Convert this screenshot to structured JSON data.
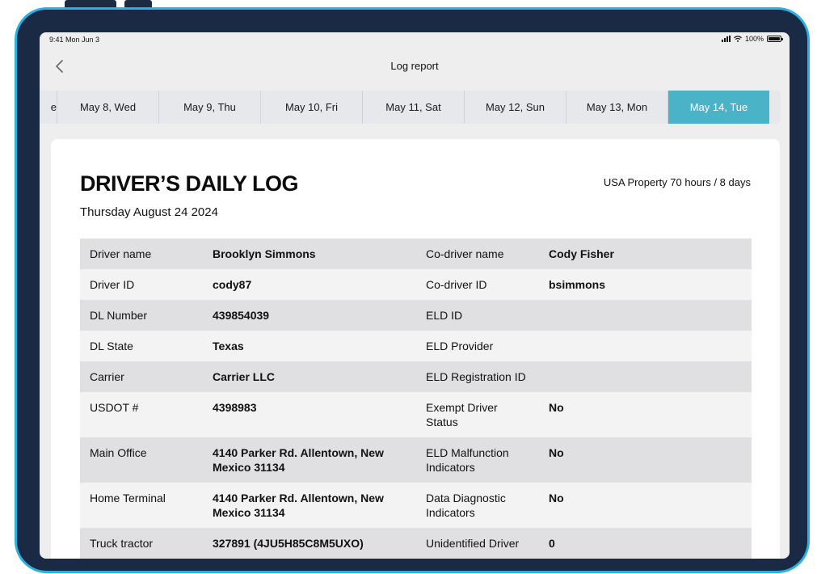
{
  "status_bar": {
    "time": "9:41 Mon Jun 3",
    "battery": "100%"
  },
  "nav": {
    "title": "Log report"
  },
  "date_tabs": [
    {
      "label": "e",
      "active": false
    },
    {
      "label": "May 8, Wed",
      "active": false
    },
    {
      "label": "May 9, Thu",
      "active": false
    },
    {
      "label": "May 10, Fri",
      "active": false
    },
    {
      "label": "May 11, Sat",
      "active": false
    },
    {
      "label": "May 12, Sun",
      "active": false
    },
    {
      "label": "May 13, Mon",
      "active": false
    },
    {
      "label": "May 14, Tue",
      "active": true
    }
  ],
  "document": {
    "title": "DRIVER’S DAILY LOG",
    "date": "Thursday August 24 2024",
    "regulation": "USA Property 70 hours / 8 days"
  },
  "rows": [
    {
      "label1": "Driver name",
      "value1": "Brooklyn Simmons",
      "label2": "Co-driver name",
      "value2": "Cody Fisher"
    },
    {
      "label1": "Driver ID",
      "value1": "cody87",
      "label2": "Co-driver ID",
      "value2": "bsimmons"
    },
    {
      "label1": "DL Number",
      "value1": "439854039",
      "label2": "ELD ID",
      "value2": ""
    },
    {
      "label1": "DL State",
      "value1": "Texas",
      "label2": "ELD Provider",
      "value2": ""
    },
    {
      "label1": "Carrier",
      "value1": "Carrier LLC",
      "label2": "ELD Registration ID",
      "value2": ""
    },
    {
      "label1": "USDOT #",
      "value1": "4398983",
      "label2": "Exempt Driver Status",
      "value2": "No"
    },
    {
      "label1": "Main Office",
      "value1": "4140 Parker Rd. Allentown, New Mexico 31134",
      "label2": "ELD Malfunction Indicators",
      "value2": "No"
    },
    {
      "label1": "Home Terminal",
      "value1": "4140 Parker Rd. Allentown, New Mexico 31134",
      "label2": "Data Diagnostic Indicators",
      "value2": "No"
    },
    {
      "label1": "Truck tractor",
      "value1": "327891 (4JU5H85C8M5UXO)",
      "label2": "Unidentified Driver",
      "value2": "0"
    }
  ],
  "colors": {
    "accent": "#4bb3c8",
    "bezel": "#1a2a44",
    "bezel_border": "#2ab0e2"
  }
}
